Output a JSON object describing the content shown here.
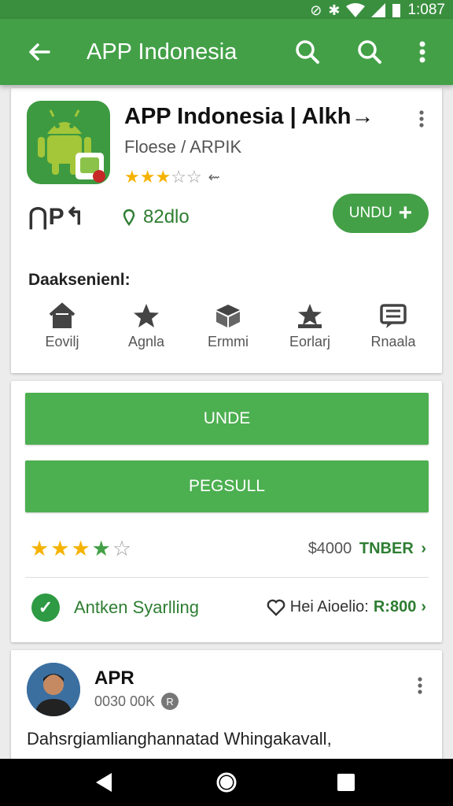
{
  "status_bar": {
    "time": "1:087"
  },
  "app_bar": {
    "title": "APP Indonesia",
    "icons": [
      "back-arrow-icon",
      "search-icon",
      "search-icon",
      "more-vert-icon"
    ]
  },
  "app_header": {
    "name": "APP Indonesia | Alkh→",
    "subtitle": "Floese / ARPIK",
    "rating_stars": 3,
    "rating_max": 5,
    "rating_small": "⇜",
    "share_text": "⋂P↰",
    "location": "82dlo",
    "install_label": "UNDU",
    "section_title": "Daaksenienl:",
    "categories": [
      {
        "label": "Eovilj",
        "icon": "home-icon"
      },
      {
        "label": "Agnla",
        "icon": "star-icon"
      },
      {
        "label": "Ermmi",
        "icon": "box-icon"
      },
      {
        "label": "Eorlarj",
        "icon": "award-icon"
      },
      {
        "label": "Rnaala",
        "icon": "message-icon"
      }
    ]
  },
  "actions": {
    "primary_button": "UNDE",
    "secondary_button": "PEGSULL",
    "stars_filled": 4,
    "stars_max": 5,
    "price": "$4000",
    "price_link": "TNBER",
    "verified_text": "Antken Syarlling",
    "heart_label": "Hei Aioelio:",
    "heart_value": "R:800"
  },
  "review": {
    "name": "APR",
    "subtitle": "0030 00K",
    "badge": "R",
    "text": "Dahsrgiamlianghannatad Whingakavall,"
  },
  "colors": {
    "green_primary": "#43a047",
    "green_dark": "#2e7d32",
    "star_gold": "#f5b301"
  }
}
